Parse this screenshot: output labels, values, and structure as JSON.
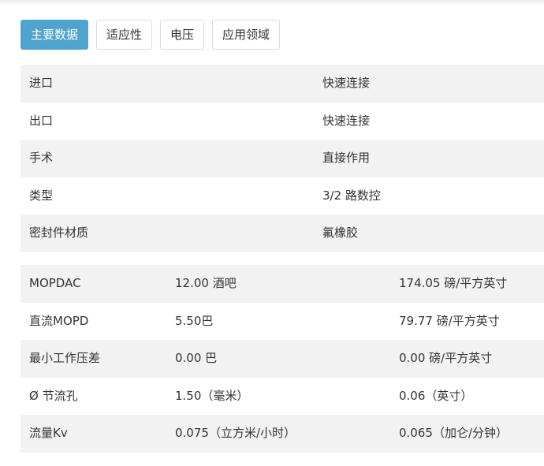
{
  "tabs": [
    {
      "label": "主要数据",
      "active": true
    },
    {
      "label": "适应性",
      "active": false
    },
    {
      "label": "电压",
      "active": false
    },
    {
      "label": "应用领域",
      "active": false
    }
  ],
  "colors": {
    "tab_active_bg": "#4fa3cf",
    "row_shade": "#f2f2f2"
  },
  "main_table": [
    {
      "label": "进口",
      "value": "快速连接"
    },
    {
      "label": "出口",
      "value": "快速连接"
    },
    {
      "label": "手术",
      "value": "直接作用"
    },
    {
      "label": "类型",
      "value": "3/2 路数控"
    },
    {
      "label": "密封件材质",
      "value": "氟橡胶"
    }
  ],
  "pressure_table": [
    {
      "label": "MOPDAC",
      "metric": "12.00 酒吧",
      "imperial": "174.05 磅/平方英寸"
    },
    {
      "label": "直流MOPD",
      "metric": "5.50巴",
      "imperial": "79.77 磅/平方英寸"
    },
    {
      "label": "最小工作压差",
      "metric": "0.00 巴",
      "imperial": "0.00 磅/平方英寸"
    },
    {
      "label": "Ø 节流孔",
      "metric": "1.50（毫米）",
      "imperial": "0.06（英寸）"
    },
    {
      "label": "流量Kv",
      "metric": "0.075（立方米/小时）",
      "imperial": "0.065（加仑/分钟）"
    }
  ]
}
